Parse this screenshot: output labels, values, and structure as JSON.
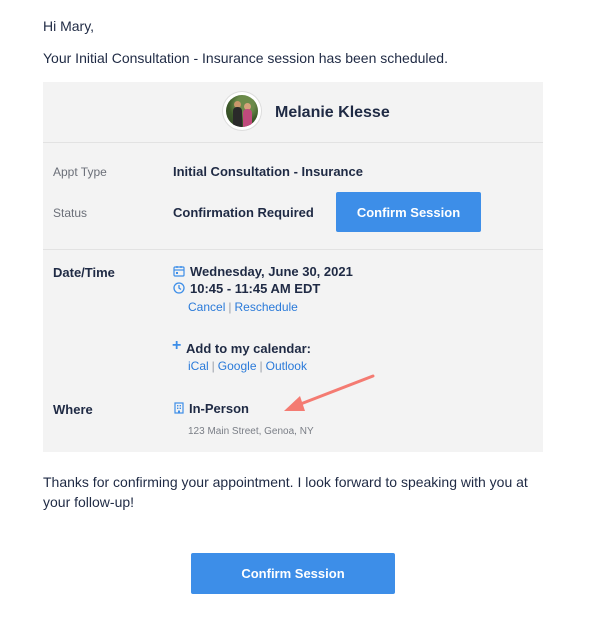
{
  "email": {
    "greeting": "Hi Mary,",
    "intro": "Your Initial Consultation - Insurance session has been scheduled.",
    "thanks": "Thanks for confirming your appointment. I look forward to speaking with you at your follow-up!"
  },
  "card": {
    "provider_name": "Melanie Klesse",
    "appt_type_label": "Appt Type",
    "appt_type_value": "Initial Consultation - Insurance",
    "status_label": "Status",
    "status_value": "Confirmation Required",
    "confirm_button_label": "Confirm Session",
    "datetime_label": "Date/Time",
    "date": "Wednesday, June 30, 2021",
    "time": "10:45 - 11:45 AM EDT",
    "cancel_link": "Cancel",
    "reschedule_link": "Reschedule",
    "add_calendar_label": "Add to my calendar:",
    "calendar_links": [
      "iCal",
      "Google",
      "Outlook"
    ],
    "where_label": "Where",
    "location_type": "In-Person",
    "address": "123 Main Street, Genoa, NY"
  },
  "footer": {
    "confirm_button_label": "Confirm Session"
  },
  "colors": {
    "accent": "#3d8ee8",
    "link": "#2a7ad9",
    "annotation_arrow": "#f47b72",
    "card_bg": "#f3f3f3"
  },
  "icons": {
    "date": "calendar-icon",
    "time": "clock-icon",
    "add": "plus-icon",
    "location": "building-icon"
  }
}
